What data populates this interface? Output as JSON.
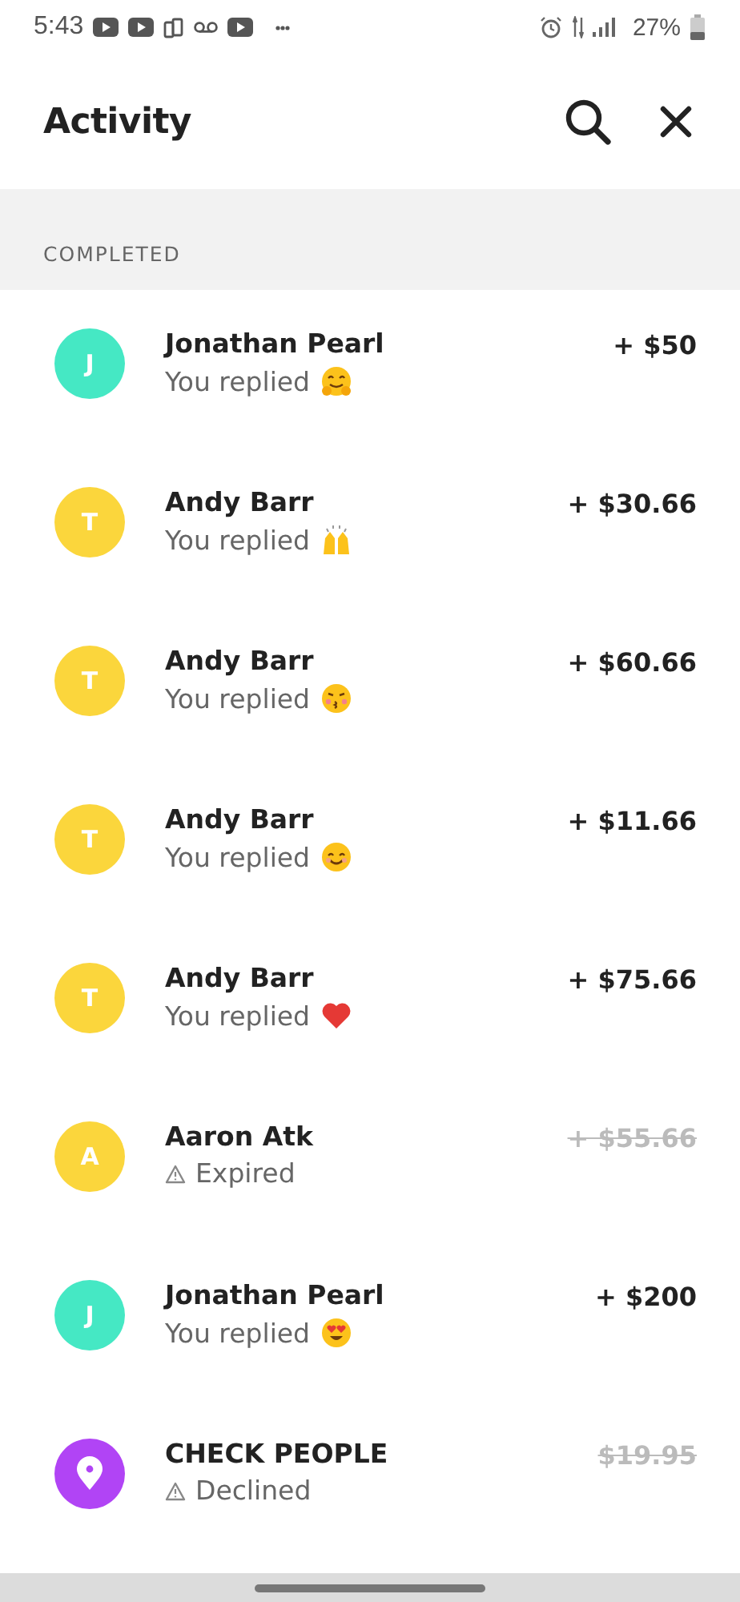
{
  "status_bar": {
    "time": "5:43",
    "battery": "27%"
  },
  "header": {
    "title": "Activity"
  },
  "section": {
    "title": "COMPLETED"
  },
  "rows": [
    {
      "avatar": {
        "kind": "letter",
        "letter": "J",
        "color": "#45e8c4"
      },
      "name": "Jonathan Pearl",
      "status": {
        "kind": "replied",
        "text": "You replied",
        "emoji": {
          "kind": "hug"
        }
      },
      "amount": {
        "text": "+ $50",
        "struck": false
      }
    },
    {
      "avatar": {
        "kind": "letter",
        "letter": "T",
        "color": "#fbd63c"
      },
      "name": "Andy Barr",
      "status": {
        "kind": "replied",
        "text": "You replied",
        "emoji": {
          "kind": "raised-hands"
        }
      },
      "amount": {
        "text": "+ $30.66",
        "struck": false
      }
    },
    {
      "avatar": {
        "kind": "letter",
        "letter": "T",
        "color": "#fbd63c"
      },
      "name": "Andy Barr",
      "status": {
        "kind": "replied",
        "text": "You replied",
        "emoji": {
          "kind": "kiss"
        }
      },
      "amount": {
        "text": "+ $60.66",
        "struck": false
      }
    },
    {
      "avatar": {
        "kind": "letter",
        "letter": "T",
        "color": "#fbd63c"
      },
      "name": "Andy Barr",
      "status": {
        "kind": "replied",
        "text": "You replied",
        "emoji": {
          "kind": "smile"
        }
      },
      "amount": {
        "text": "+ $11.66",
        "struck": false
      }
    },
    {
      "avatar": {
        "kind": "letter",
        "letter": "T",
        "color": "#fbd63c"
      },
      "name": "Andy Barr",
      "status": {
        "kind": "replied",
        "text": "You replied",
        "emoji": {
          "kind": "heart"
        }
      },
      "amount": {
        "text": "+ $75.66",
        "struck": false
      }
    },
    {
      "avatar": {
        "kind": "letter",
        "letter": "A",
        "color": "#fbd63c"
      },
      "name": "Aaron Atk",
      "status": {
        "kind": "warning",
        "text": "Expired"
      },
      "amount": {
        "text": "+ $55.66",
        "struck": true
      }
    },
    {
      "avatar": {
        "kind": "letter",
        "letter": "J",
        "color": "#45e8c4"
      },
      "name": "Jonathan Pearl",
      "status": {
        "kind": "replied",
        "text": "You replied",
        "emoji": {
          "kind": "heart-eyes"
        }
      },
      "amount": {
        "text": "+ $200",
        "struck": false
      }
    },
    {
      "avatar": {
        "kind": "pin",
        "color": "#b144f5"
      },
      "name": "CHECK PEOPLE",
      "status": {
        "kind": "warning",
        "text": "Declined"
      },
      "amount": {
        "text": "$19.95",
        "struck": true
      }
    }
  ]
}
